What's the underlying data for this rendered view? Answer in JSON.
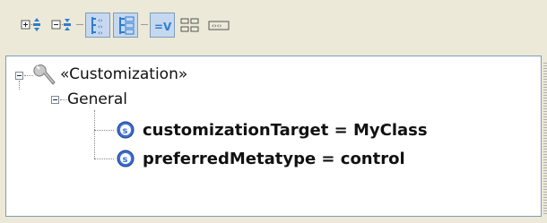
{
  "toolbar": {
    "buttons": [
      {
        "icon": "expand-all-icon",
        "active": false
      },
      {
        "icon": "collapse-all-icon",
        "active": false
      },
      {
        "icon": "show-stereotypes-icon",
        "active": true
      },
      {
        "icon": "show-hierarchy-icon",
        "active": true
      },
      {
        "icon": "show-values-icon",
        "active": true,
        "text": "=V"
      },
      {
        "icon": "show-groups-icon",
        "active": false
      },
      {
        "icon": "show-properties-icon",
        "active": false
      }
    ]
  },
  "tree": {
    "root": {
      "label": "«Customization»",
      "icon": "wrench-icon"
    },
    "group": {
      "label": "General"
    },
    "items": [
      {
        "label": "customizationTarget = MyClass",
        "icon": "slot-icon"
      },
      {
        "label": "preferredMetatype = control",
        "icon": "slot-icon"
      }
    ]
  },
  "colors": {
    "toolbar_bg": "#ece9d8",
    "active_button_bg": "#c6d8ef",
    "panel_border": "#7f9db9",
    "slot_icon_blue": "#3b6fd6"
  }
}
